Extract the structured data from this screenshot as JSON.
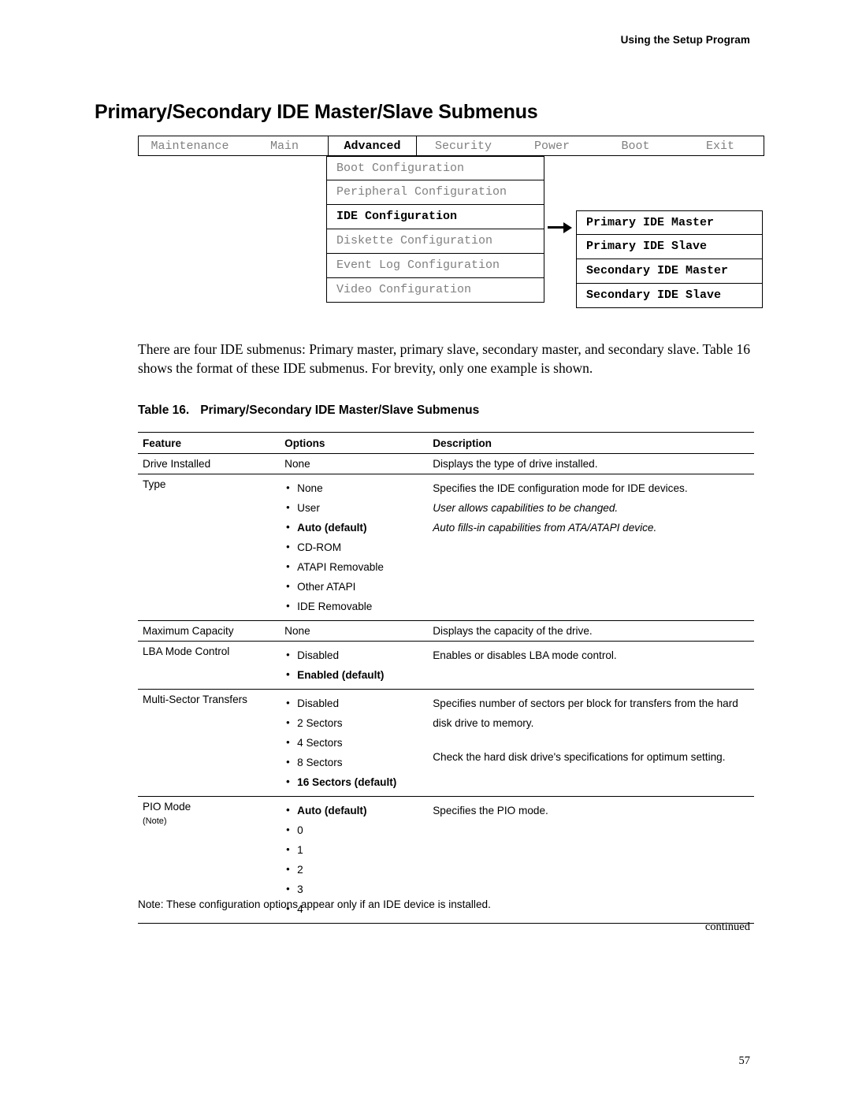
{
  "header": {
    "running_head": "Using the Setup Program"
  },
  "title": "Primary/Secondary IDE Master/Slave Submenus",
  "menu_diagram": {
    "menubar": [
      {
        "label": "Maintenance",
        "active": false
      },
      {
        "label": "Main",
        "active": false
      },
      {
        "label": "Advanced",
        "active": true
      },
      {
        "label": "Security",
        "active": false
      },
      {
        "label": "Power",
        "active": false
      },
      {
        "label": "Boot",
        "active": false
      },
      {
        "label": "Exit",
        "active": false
      }
    ],
    "left_items": [
      {
        "label": "Boot Configuration",
        "bold": false
      },
      {
        "label": "Peripheral Configuration",
        "bold": false
      },
      {
        "label": "IDE Configuration",
        "bold": true
      },
      {
        "label": "Diskette Configuration",
        "bold": false
      },
      {
        "label": "Event Log Configuration",
        "bold": false
      },
      {
        "label": "Video Configuration",
        "bold": false
      }
    ],
    "right_items": [
      {
        "label": "Primary IDE Master"
      },
      {
        "label": "Primary IDE Slave"
      },
      {
        "label": "Secondary IDE Master"
      },
      {
        "label": "Secondary IDE Slave"
      }
    ]
  },
  "paragraph": "There are four IDE submenus:  Primary master, primary slave, secondary master, and secondary slave.  Table 16 shows the format of these IDE submenus.  For brevity, only one example is shown.",
  "table": {
    "caption_number": "Table 16.",
    "caption_text": "Primary/Secondary IDE Master/Slave Submenus",
    "headers": [
      "Feature",
      "Options",
      "Description"
    ],
    "rows": [
      {
        "feature": "Drive Installed",
        "options": [
          "None"
        ],
        "description": [
          "Displays the type of drive installed."
        ]
      },
      {
        "feature": "Type",
        "options": [
          "None",
          "User",
          "Auto (default)",
          "CD-ROM",
          "ATAPI Removable",
          "Other ATAPI",
          "IDE Removable"
        ],
        "description": [
          "Specifies the IDE configuration mode for IDE devices.",
          "User allows capabilities to be changed.",
          "Auto fills-in capabilities from ATA/ATAPI device."
        ]
      },
      {
        "feature": "Maximum Capacity",
        "options": [
          "None"
        ],
        "description": [
          "Displays the capacity of the drive."
        ]
      },
      {
        "feature": "LBA Mode Control",
        "options": [
          "Disabled",
          "Enabled (default)"
        ],
        "description": [
          "Enables or disables LBA mode control."
        ]
      },
      {
        "feature": "Multi-Sector Transfers",
        "options": [
          "Disabled",
          "2 Sectors",
          "4 Sectors",
          "8 Sectors",
          "16 Sectors (default)"
        ],
        "description": [
          "Specifies number of sectors per block for transfers from the hard disk drive to memory.",
          "Check the hard disk drive's specifications for optimum setting."
        ]
      },
      {
        "feature": "PIO Mode",
        "feature_note": "(Note)",
        "options": [
          "Auto (default)",
          "0",
          "1",
          "2",
          "3",
          "4"
        ],
        "description": [
          "Specifies the PIO mode."
        ]
      }
    ],
    "footnote": "Note:  These configuration options appear only if an IDE device is installed."
  },
  "continued_label": "continued",
  "page_number": "57"
}
